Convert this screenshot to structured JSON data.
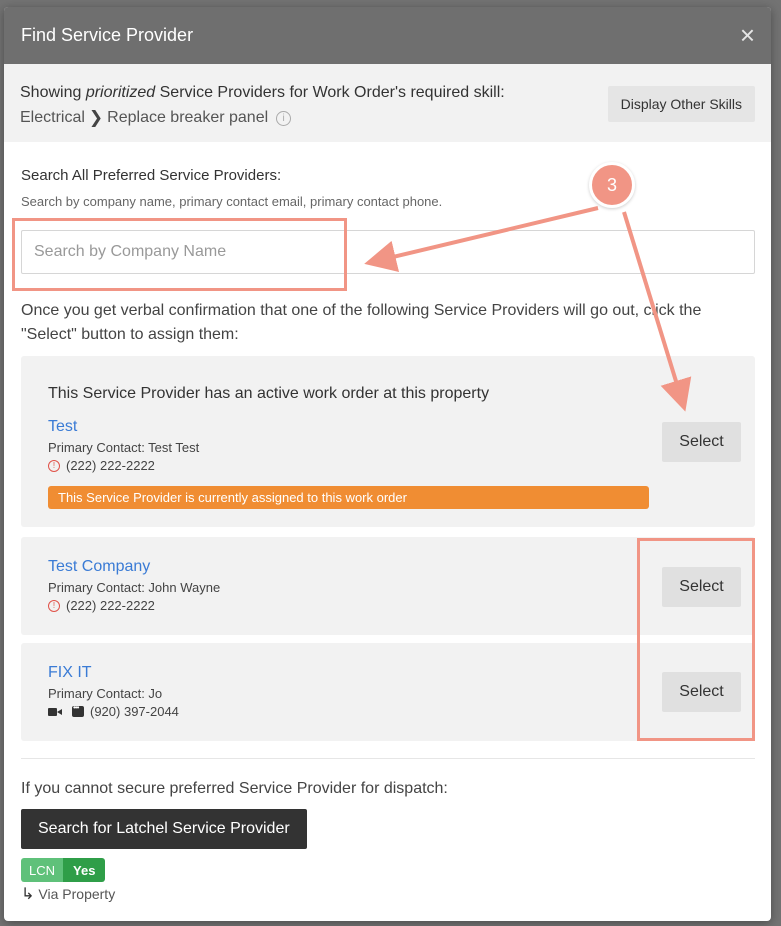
{
  "modal": {
    "title": "Find Service Provider",
    "close_glyph": "×"
  },
  "skill": {
    "prefix": "Showing ",
    "emphasis": "prioritized",
    "suffix": " Service Providers for Work Order's required skill:",
    "category": "Electrical",
    "separator_glyph": "❯",
    "task": "Replace breaker panel",
    "info_glyph": "i",
    "display_other_label": "Display Other Skills"
  },
  "search": {
    "label": "Search All Preferred Service Providers:",
    "help": "Search by company name, primary contact email, primary contact phone.",
    "placeholder": "Search by Company Name",
    "value": ""
  },
  "instructions": "Once you get verbal confirmation that one of the following Service Providers will go out, click the \"Select\" button to assign them:",
  "providers": [
    {
      "notice": "This Service Provider has an active work order at this property",
      "name": "Test",
      "contact": "Primary Contact: Test Test",
      "phone": "(222) 222-2222",
      "banner": "This Service Provider is currently assigned to this work order",
      "select_label": "Select"
    },
    {
      "name": "Test Company",
      "contact": "Primary Contact: John Wayne",
      "phone": "(222) 222-2222",
      "select_label": "Select"
    },
    {
      "name": "FIX IT",
      "contact": "Primary Contact: Jo",
      "phone": "(920) 397-2044",
      "select_label": "Select"
    }
  ],
  "fallback": {
    "text": "If you cannot secure preferred Service Provider for dispatch:",
    "button_label": "Search for Latchel Service Provider",
    "toggle_left": "LCN",
    "toggle_right": "Yes",
    "via_glyph": "↳",
    "via": "Via Property"
  },
  "annotation": {
    "step_number": "3",
    "color": "#f19585"
  },
  "colors": {
    "header_bg": "#6f6f6f",
    "link": "#3a7bd5",
    "banner": "#f08d33",
    "primary_button": "#333333",
    "toggle_green": "#2f9e48"
  }
}
